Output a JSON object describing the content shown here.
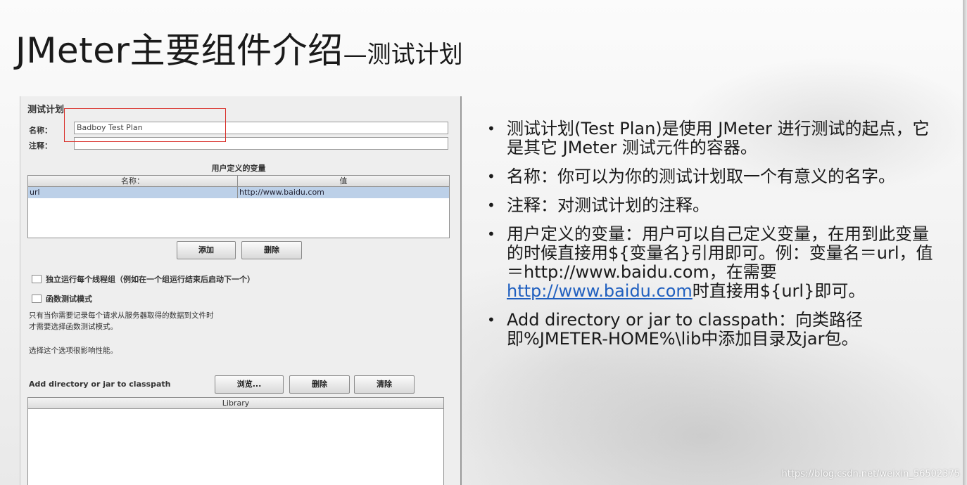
{
  "title": {
    "main": "JMeter主要组件介绍",
    "sub": "—测试计划"
  },
  "jmeter_panel": {
    "heading": "测试计划",
    "name_label": "名称：",
    "name_value": "Badboy Test Plan",
    "comment_label": "注释：",
    "comment_value": "",
    "udv_title": "用户定义的变量",
    "udv_columns": [
      "名称：",
      "值"
    ],
    "udv_rows": [
      {
        "name": "url",
        "value": "http://www.baidu.com"
      }
    ],
    "add_button": "添加",
    "delete_button": "删除",
    "checkbox_serialize": "独立运行每个线程组（例如在一个组运行结束后启动下一个）",
    "checkbox_functional": "函数测试模式",
    "functional_note_1": "只有当你需要记录每个请求从服务器取得的数据到文件时",
    "functional_note_2": "才需要选择函数测试模式。",
    "performance_note": "选择这个选项很影响性能。",
    "classpath_label": "Add directory or jar to classpath",
    "browse_button": "浏览...",
    "cp_delete_button": "删除",
    "cp_clear_button": "清除",
    "library_column": "Library"
  },
  "bullets": [
    {
      "text": "测试计划(Test Plan)是使用 JMeter 进行测试的起点，它是其它 JMeter 测试元件的容器。"
    },
    {
      "text": "名称：你可以为你的测试计划取一个有意义的名字。"
    },
    {
      "text": "注释：对测试计划的注释。"
    },
    {
      "before": "用户定义的变量：用户可以自己定义变量，在用到此变量的时候直接用${变量名}引用即可。例：变量名＝url，值＝http://www.baidu.com，在需要",
      "link": "http://www.baidu.com",
      "after": "时直接用${url}即可。"
    },
    {
      "text": "Add directory or jar to classpath：向类路径即%JMETER-HOME%\\lib中添加目录及jar包。"
    }
  ],
  "watermark": "https://blog.csdn.net/weixin_56502375",
  "colors": {
    "highlight_box": "#d9302a",
    "link": "#1f5fbf",
    "selected_row": "#bcd0e8"
  }
}
